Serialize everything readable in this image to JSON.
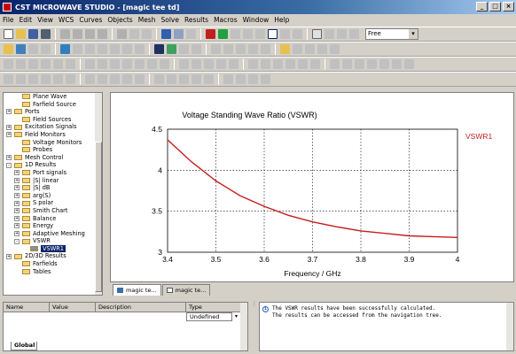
{
  "window": {
    "title": "CST MICROWAVE STUDIO - [magic tee td]"
  },
  "window_buttons": [
    "_",
    "□",
    "×"
  ],
  "menu": [
    "File",
    "Edit",
    "View",
    "WCS",
    "Curves",
    "Objects",
    "Mesh",
    "Solve",
    "Results",
    "Macros",
    "Window",
    "Help"
  ],
  "toolbar": {
    "mode_value": "Free"
  },
  "tree": {
    "items": [
      {
        "label": "Plane Wave",
        "depth": 1,
        "exp": ""
      },
      {
        "label": "Farfield Source",
        "depth": 1,
        "exp": ""
      },
      {
        "label": "Ports",
        "depth": 0,
        "exp": "+"
      },
      {
        "label": "Field Sources",
        "depth": 1,
        "exp": ""
      },
      {
        "label": "Excitation Signals",
        "depth": 0,
        "exp": "+"
      },
      {
        "label": "Field Monitors",
        "depth": 0,
        "exp": "+"
      },
      {
        "label": "Voltage Monitors",
        "depth": 1,
        "exp": ""
      },
      {
        "label": "Probes",
        "depth": 1,
        "exp": ""
      },
      {
        "label": "Mesh Control",
        "depth": 0,
        "exp": "+"
      },
      {
        "label": "1D Results",
        "depth": 0,
        "exp": "-"
      },
      {
        "label": "Port signals",
        "depth": 1,
        "exp": "+"
      },
      {
        "label": "|S| linear",
        "depth": 1,
        "exp": "+"
      },
      {
        "label": "|S| dB",
        "depth": 1,
        "exp": "+"
      },
      {
        "label": "arg(S)",
        "depth": 1,
        "exp": "+"
      },
      {
        "label": "S polar",
        "depth": 1,
        "exp": "+"
      },
      {
        "label": "Smith Chart",
        "depth": 1,
        "exp": "+"
      },
      {
        "label": "Balance",
        "depth": 1,
        "exp": "+"
      },
      {
        "label": "Energy",
        "depth": 1,
        "exp": "+"
      },
      {
        "label": "Adaptive Meshing",
        "depth": 1,
        "exp": "+"
      },
      {
        "label": "VSWR",
        "depth": 1,
        "exp": "-"
      },
      {
        "label": "VSWR1",
        "depth": 2,
        "exp": "",
        "selected": true
      },
      {
        "label": "2D/3D Results",
        "depth": 0,
        "exp": "+"
      },
      {
        "label": "Farfields",
        "depth": 1,
        "exp": ""
      },
      {
        "label": "Tables",
        "depth": 1,
        "exp": ""
      }
    ]
  },
  "doc_tabs": [
    {
      "label": "magic te..."
    },
    {
      "label": "magic te..."
    }
  ],
  "param_table": {
    "headers": [
      "Name",
      "Value",
      "Description",
      "Type"
    ],
    "row": [
      "",
      "",
      "",
      "Undefined"
    ],
    "tab_label": "Global"
  },
  "messages": [
    "The VSWR results have been successfully calculated.",
    "The results can be accessed from the navigation tree."
  ],
  "chart_data": {
    "type": "line",
    "title": "Voltage Standing Wave Ratio (VSWR)",
    "xlabel": "Frequency / GHz",
    "ylabel": "",
    "xlim": [
      3.4,
      4.0
    ],
    "ylim": [
      3.0,
      4.5
    ],
    "x_ticks": [
      "3.4",
      "3.5",
      "3.6",
      "3.7",
      "3.8",
      "3.9",
      "4"
    ],
    "y_ticks": [
      "3",
      "3.5",
      "4",
      "4.5"
    ],
    "grid": true,
    "legend_position": "top-right",
    "series": [
      {
        "name": "VSWR1",
        "color": "#c41e1e",
        "x": [
          3.4,
          3.45,
          3.5,
          3.55,
          3.6,
          3.65,
          3.7,
          3.75,
          3.8,
          3.85,
          3.9,
          3.95,
          4.0
        ],
        "y": [
          4.37,
          4.1,
          3.87,
          3.69,
          3.56,
          3.45,
          3.37,
          3.31,
          3.26,
          3.23,
          3.2,
          3.19,
          3.18
        ]
      }
    ]
  }
}
